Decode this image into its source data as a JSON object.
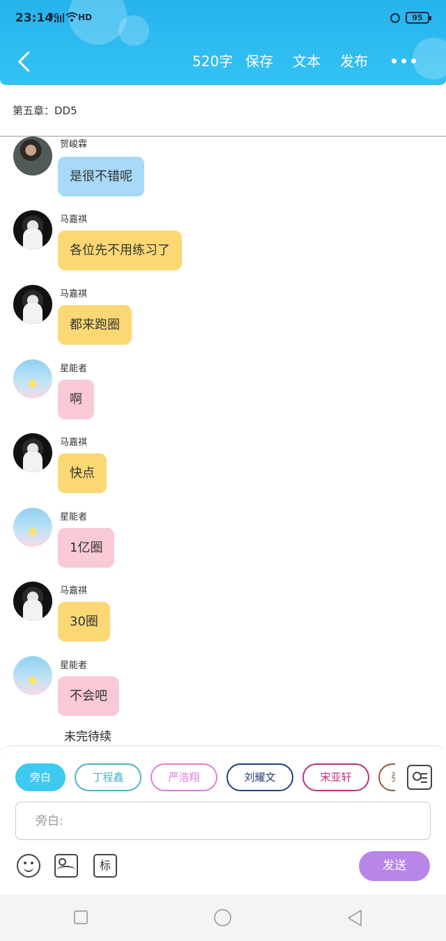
{
  "status": {
    "time": "23:14",
    "network": "4G",
    "hd": "HD",
    "battery": "95"
  },
  "toolbar": {
    "word_count": "520字",
    "save": "保存",
    "text": "文本",
    "publish": "发布"
  },
  "chapter_title": "第五章：DD5",
  "messages": [
    {
      "sender": "贺峻霖",
      "text": "是很不错呢",
      "avatar": "avatar-hxl",
      "color": "blue"
    },
    {
      "sender": "马嘉祺",
      "text": "各位先不用练习了",
      "avatar": "avatar-mjq",
      "color": "yellow"
    },
    {
      "sender": "马嘉祺",
      "text": "都来跑圈",
      "avatar": "avatar-mjq",
      "color": "yellow"
    },
    {
      "sender": "星能者",
      "text": "啊",
      "avatar": "avatar-xnz",
      "color": "pink"
    },
    {
      "sender": "马嘉祺",
      "text": "快点",
      "avatar": "avatar-mjq",
      "color": "yellow"
    },
    {
      "sender": "星能者",
      "text": "1亿圈",
      "avatar": "avatar-xnz",
      "color": "pink"
    },
    {
      "sender": "马嘉祺",
      "text": "30圈",
      "avatar": "avatar-mjq",
      "color": "yellow"
    },
    {
      "sender": "星能者",
      "text": "不会吧",
      "avatar": "avatar-xnz",
      "color": "pink"
    }
  ],
  "to_be_continued": "未完待续",
  "roles": [
    {
      "label": "旁白",
      "color": "#3ec9f0",
      "active": true
    },
    {
      "label": "丁程鑫",
      "color": "#4bb0c8",
      "active": false
    },
    {
      "label": "严浩翔",
      "color": "#e07be0",
      "active": false
    },
    {
      "label": "刘耀文",
      "color": "#1f3f7a",
      "active": false
    },
    {
      "label": "宋亚轩",
      "color": "#b8307a",
      "active": false
    },
    {
      "label": "张",
      "color": "#8a5a3a",
      "active": false
    }
  ],
  "input": {
    "placeholder": "旁白:"
  },
  "tools": {
    "tag_label": "标"
  },
  "send_label": "发送"
}
